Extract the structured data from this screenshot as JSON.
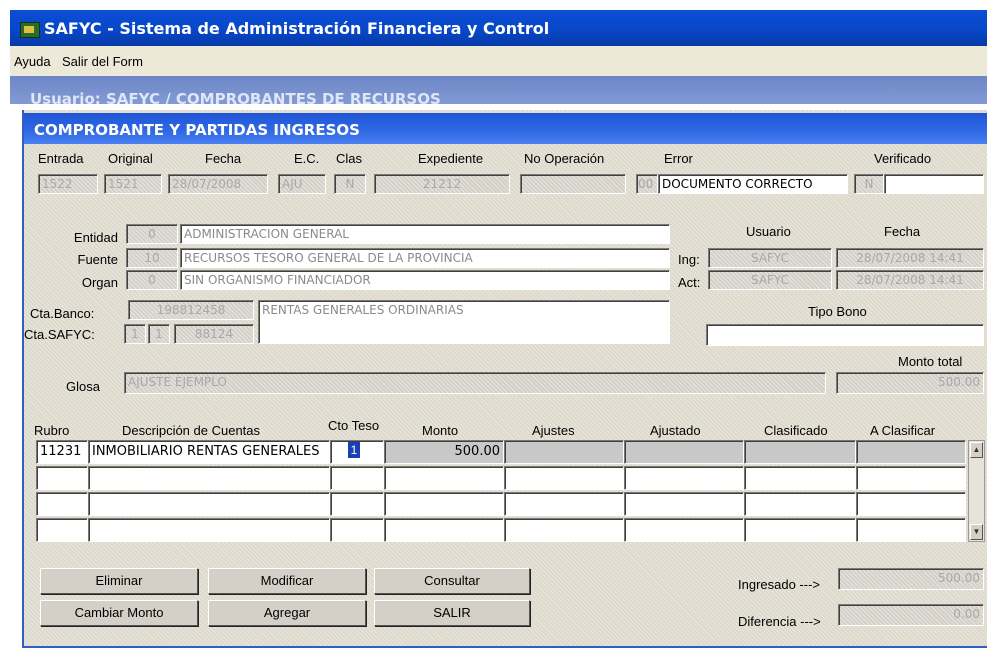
{
  "window": {
    "title": "SAFYC - Sistema de Administración Financiera y Control"
  },
  "menu": {
    "items": [
      "Ayuda",
      "Salir del Form"
    ]
  },
  "background_form": {
    "title": "Usuario: SAFYC  /  COMPROBANTES DE RECURSOS"
  },
  "form": {
    "title": "COMPROBANTE Y PARTIDAS INGRESOS"
  },
  "header": {
    "labels": {
      "entrada": "Entrada",
      "original": "Original",
      "fecha": "Fecha",
      "ec": "E.C.",
      "clas": "Clas",
      "expediente": "Expediente",
      "no_operacion": "No Operación",
      "error": "Error",
      "verificado": "Verificado"
    },
    "values": {
      "entrada": "1522",
      "original": "1521",
      "fecha": "28/07/2008",
      "ec": "AJU",
      "clas": "N",
      "expediente": "21212",
      "no_operacion": "",
      "error_code": "00",
      "error_text": "DOCUMENTO CORRECTO",
      "verificado_flag": "N",
      "verificado": ""
    }
  },
  "details": {
    "labels": {
      "entidad": "Entidad",
      "fuente": "Fuente",
      "organ": "Organ",
      "cta_banco": "Cta.Banco:",
      "cta_safyc": "Cta.SAFYC:",
      "usuario": "Usuario",
      "fecha": "Fecha",
      "ing": "Ing:",
      "act": "Act:",
      "tipo_bono": "Tipo Bono",
      "monto_total": "Monto total",
      "glosa": "Glosa"
    },
    "entidad_code": "0",
    "entidad_desc": "ADMINISTRACION GENERAL",
    "fuente_code": "10",
    "fuente_desc": "RECURSOS TESORO GENERAL DE LA PROVINCIA",
    "organ_code": "0",
    "organ_desc": "SIN ORGANISMO FINANCIADOR",
    "cta_banco_num": "198812458",
    "cta_banco_desc": "RENTAS GENERALES ORDINARIAS",
    "cta_safyc_1": "1",
    "cta_safyc_2": "1",
    "cta_safyc_3": "88124",
    "ing_usuario": "SAFYC",
    "ing_fecha": "28/07/2008 14:41",
    "act_usuario": "SAFYC",
    "act_fecha": "28/07/2008 14:41",
    "tipo_bono": "",
    "glosa": "AJUSTE EJEMPLO",
    "monto_total": "500.00"
  },
  "grid": {
    "headers": {
      "rubro": "Rubro",
      "descripcion": "Descripción de Cuentas",
      "cto_teso": "Cto Teso",
      "monto": "Monto",
      "ajustes": "Ajustes",
      "ajustado": "Ajustado",
      "clasificado": "Clasificado",
      "a_clasificar": "A Clasificar"
    },
    "rows": [
      {
        "rubro": "11231",
        "descripcion": "INMOBILIARIO RENTAS GENERALES",
        "cto_teso": "1",
        "monto": "500.00",
        "ajustes": "",
        "ajustado": "",
        "clasificado": "",
        "a_clasificar": ""
      }
    ]
  },
  "buttons": {
    "eliminar": "Eliminar",
    "modificar": "Modificar",
    "consultar": "Consultar",
    "cambiar_monto": "Cambiar Monto",
    "agregar": "Agregar",
    "salir": "SALIR"
  },
  "totals": {
    "ingresado_label": "Ingresado --->",
    "ingresado": "500.00",
    "diferencia_label": "Diferencia --->",
    "diferencia": "0.00"
  }
}
